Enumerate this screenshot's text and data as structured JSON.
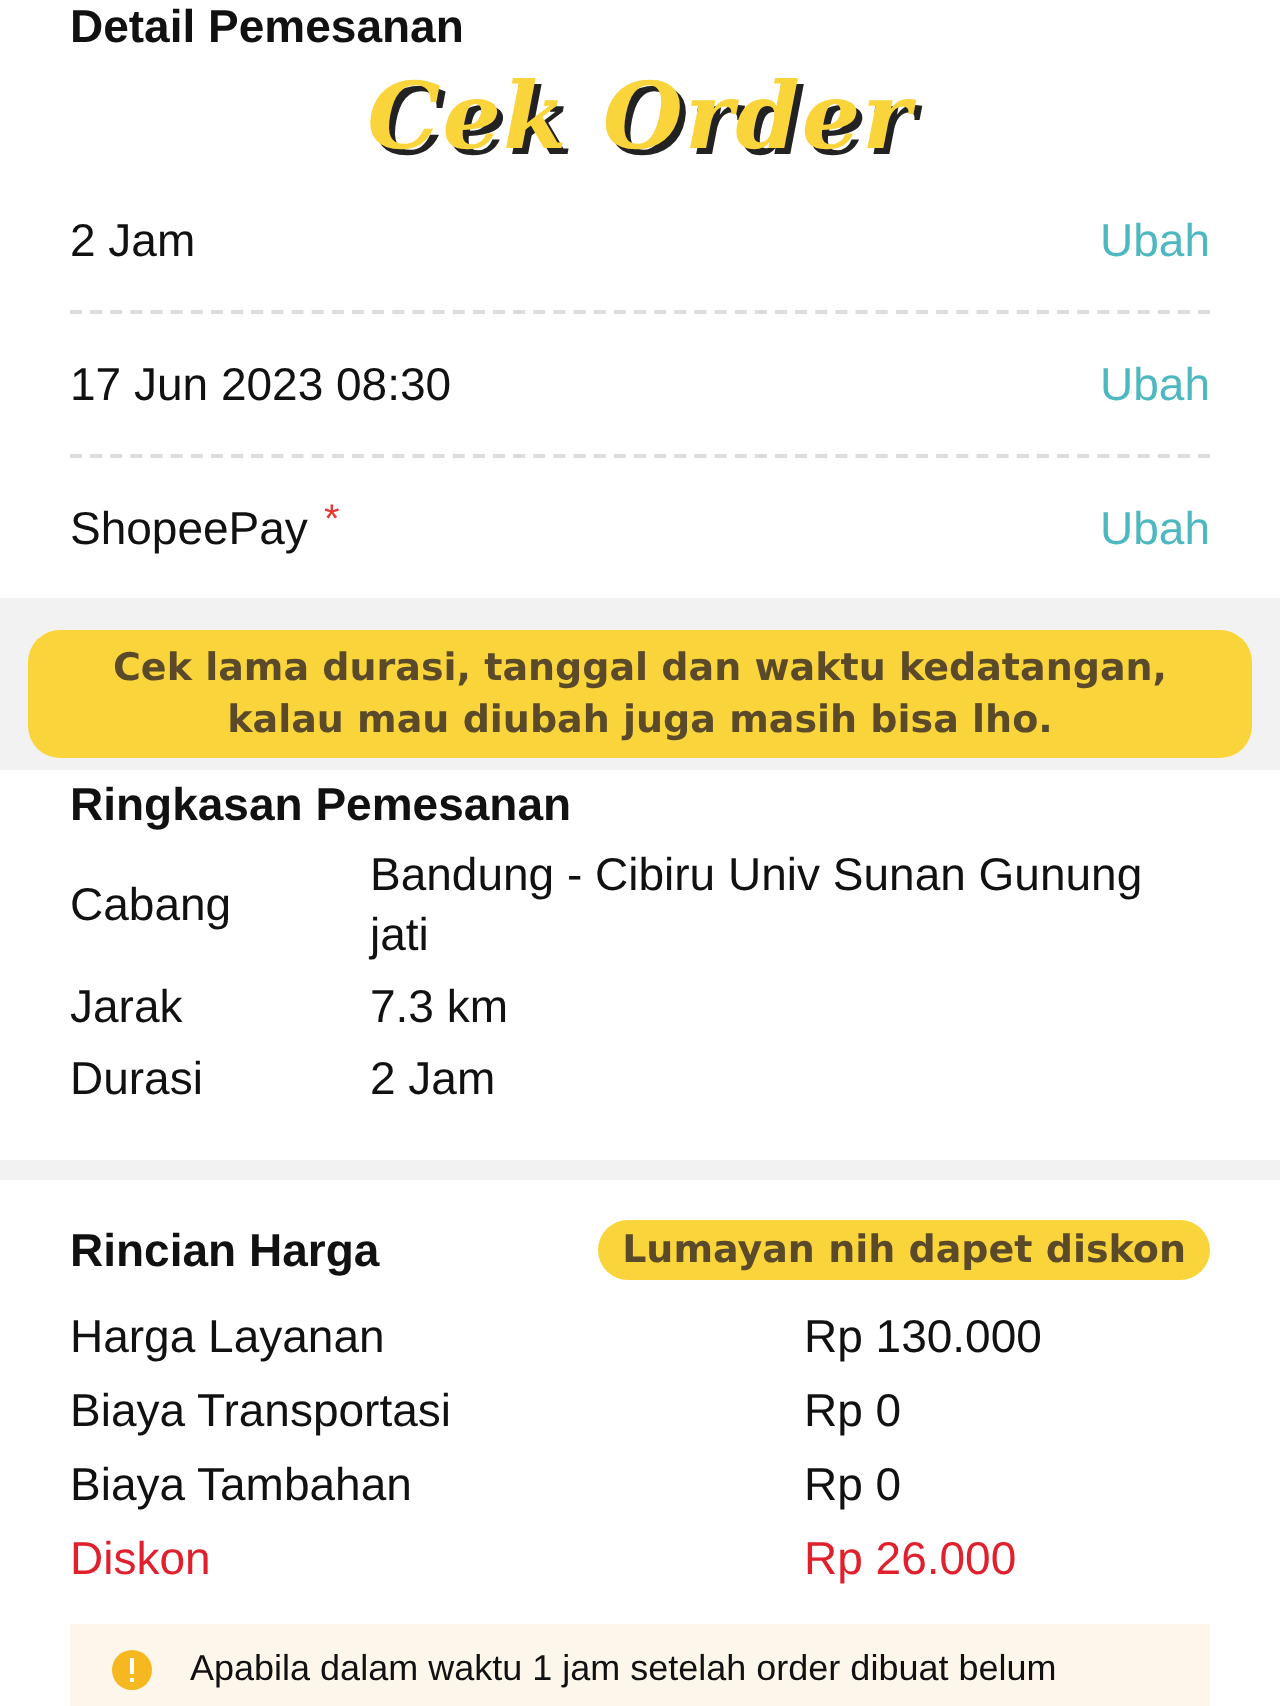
{
  "detail": {
    "title": "Detail Pemesanan",
    "rows": [
      {
        "value": "2 Jam",
        "action": "Ubah"
      },
      {
        "value": "17 Jun 2023 08:30",
        "action": "Ubah"
      },
      {
        "value": "ShopeePay",
        "mark": "*",
        "action": "Ubah"
      }
    ]
  },
  "summary": {
    "title": "Ringkasan Pemesanan",
    "rows": [
      {
        "label": "Cabang",
        "value": "Bandung - Cibiru Univ Sunan Gunung jati"
      },
      {
        "label": "Jarak",
        "value": "7.3 km"
      },
      {
        "label": "Durasi",
        "value": "2 Jam"
      }
    ]
  },
  "prices": {
    "title": "Rincian Harga",
    "rows": [
      {
        "label": "Harga Layanan",
        "value": "Rp 130.000",
        "kind": "normal"
      },
      {
        "label": "Biaya Transportasi",
        "value": "Rp 0",
        "kind": "normal"
      },
      {
        "label": "Biaya Tambahan",
        "value": "Rp 0",
        "kind": "normal"
      },
      {
        "label": "Diskon",
        "value": "Rp 26.000",
        "kind": "discount"
      }
    ]
  },
  "note": {
    "text": "Apabila dalam waktu 1 jam setelah order dibuat belum"
  },
  "overlays": {
    "title": "Cek Order",
    "captions": [
      "Cek lama durasi, tanggal dan waktu kedatangan,\nkalau mau diubah juga masih bisa lho.",
      "Lumayan nih dapet diskon"
    ]
  }
}
